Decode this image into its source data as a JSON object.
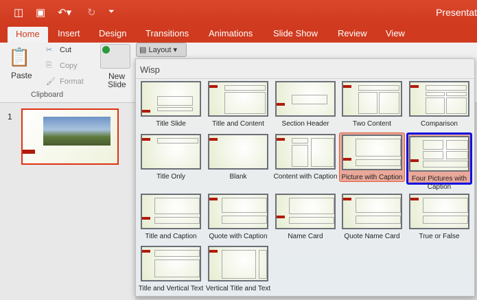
{
  "titlebar": {
    "title": "Presentat",
    "icons": [
      "sidebar-icon",
      "save-icon",
      "undo-icon",
      "redo-icon",
      "customize-icon"
    ]
  },
  "tabs": [
    "Home",
    "Insert",
    "Design",
    "Transitions",
    "Animations",
    "Slide Show",
    "Review",
    "View"
  ],
  "ribbon": {
    "paste": "Paste",
    "cut": "Cut",
    "copy": "Copy",
    "format": "Format",
    "clipboard": "Clipboard",
    "new_slide_1": "New",
    "new_slide_2": "Slide",
    "layout": "Layout"
  },
  "slides": {
    "number": "1"
  },
  "gallery": {
    "theme": "Wisp",
    "layouts": [
      "Title Slide",
      "Title and Content",
      "Section Header",
      "Two Content",
      "Comparison",
      "Title Only",
      "Blank",
      "Content with Caption",
      "Picture with Caption",
      "Four Pictures with Caption",
      "Title and Caption",
      "Quote with Caption",
      "Name Card",
      "Quote Name Card",
      "True or False",
      "Title and Vertical Text",
      "Vertical Title and Text"
    ],
    "selected": "Picture with Caption",
    "hovered": "Four Pictures with Caption"
  }
}
